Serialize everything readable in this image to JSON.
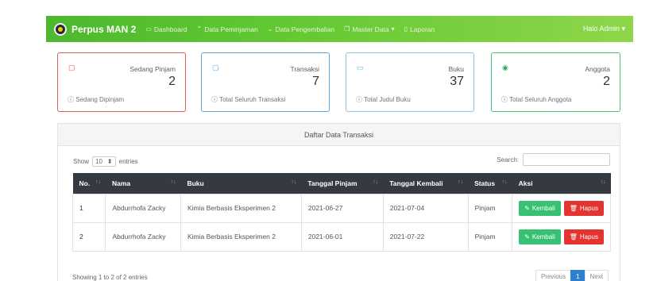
{
  "navbar": {
    "brand": "Perpus MAN 2",
    "items": [
      {
        "icon": "dashboard-icon",
        "glyph": "▭",
        "label": "Dashboard"
      },
      {
        "icon": "up-arrow-icon",
        "glyph": "⌃",
        "label": "Data Peminjaman"
      },
      {
        "icon": "down-arrow-icon",
        "glyph": "⌄",
        "label": "Data Pengembalian"
      },
      {
        "icon": "folder-icon",
        "glyph": "❐",
        "label": "Master Data",
        "caret": "▾"
      },
      {
        "icon": "file-icon",
        "glyph": "▯",
        "label": "Laporan"
      }
    ],
    "user": "Halo Admin"
  },
  "cards": [
    {
      "title": "Sedang Pinjam",
      "value": "2",
      "footer": "Sedang Dipinjam",
      "icon": "file-icon"
    },
    {
      "title": "Transaksi",
      "value": "7",
      "footer": "Total Seluruh Transaksi",
      "icon": "file-icon"
    },
    {
      "title": "Buku",
      "value": "37",
      "footer": "Total Judul Buku",
      "icon": "book-icon"
    },
    {
      "title": "Anggota",
      "value": "2",
      "footer": "Total Seluruh Anggota",
      "icon": "user-icon"
    }
  ],
  "panel": {
    "title": "Daftar Data Transaksi",
    "show_label": "Show",
    "entries_value": "10",
    "entries_label": "entries",
    "search_label": "Search:",
    "search_value": ""
  },
  "table": {
    "headers": [
      "No.",
      "Nama",
      "Buku",
      "Tanggal Pinjam",
      "Tanggal Kembali",
      "Status",
      "Aksi"
    ],
    "rows": [
      {
        "no": "1",
        "nama": "Abdurrhofa Zacky",
        "buku": "Kimia Berbasis Eksperimen 2",
        "pinjam": "2021-06-27",
        "kembali": "2021-07-04",
        "status": "Pinjam"
      },
      {
        "no": "2",
        "nama": "Abdurrhofa Zacky",
        "buku": "Kimia Berbasis Eksperimen 2",
        "pinjam": "2021-06-01",
        "kembali": "2021-07-22",
        "status": "Pinjam"
      }
    ],
    "btn_kembali": "Kembali",
    "btn_hapus": "Hapus"
  },
  "footer": {
    "info": "Showing 1 to 2 of 2 entries",
    "previous": "Previous",
    "page": "1",
    "next": "Next"
  },
  "colors": {
    "accent": "#62c832",
    "danger": "#e3342f",
    "success": "#38c172",
    "primary": "#2f7fd1"
  }
}
